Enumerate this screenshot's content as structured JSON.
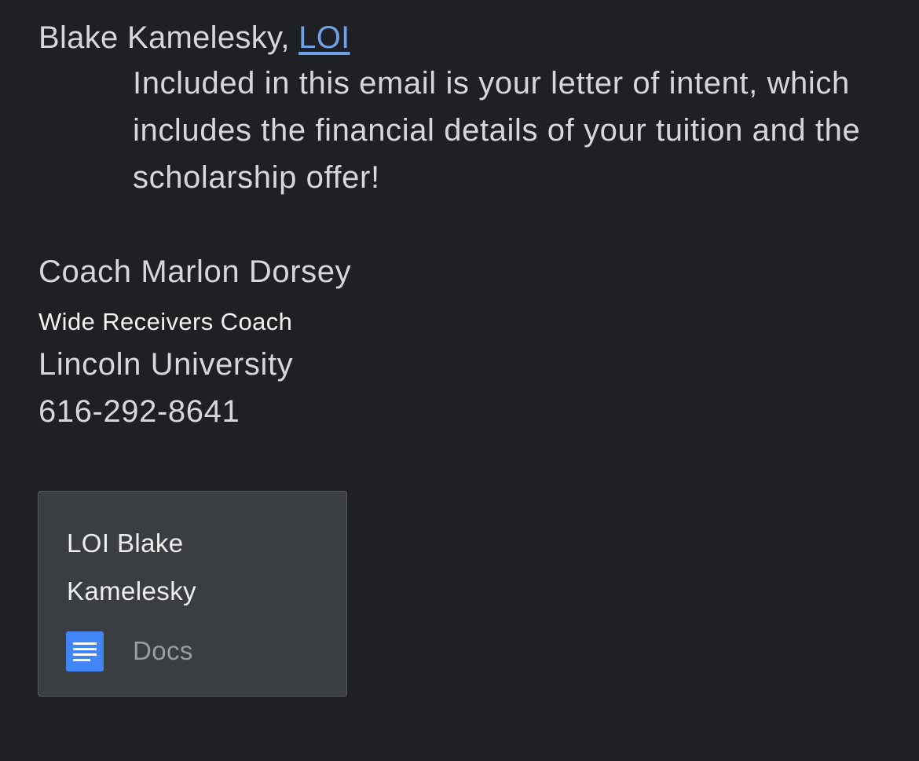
{
  "email": {
    "greeting_name": "Blake Kamelesky,",
    "link_text": "LOI",
    "body": "Included in this email is your letter of intent, which includes the financial details of your tuition and the scholarship offer!"
  },
  "signature": {
    "name": "Coach Marlon Dorsey",
    "title": "Wide Receivers Coach",
    "organization": "Lincoln University",
    "phone": "616-292-8641"
  },
  "attachment": {
    "name": "LOI Blake Kamelesky",
    "type_label": "Docs",
    "icon": "google-docs-icon",
    "icon_color": "#4285f4"
  },
  "colors": {
    "background": "#1f2024",
    "link": "#6fa0e8",
    "card": "#3a3d42"
  }
}
